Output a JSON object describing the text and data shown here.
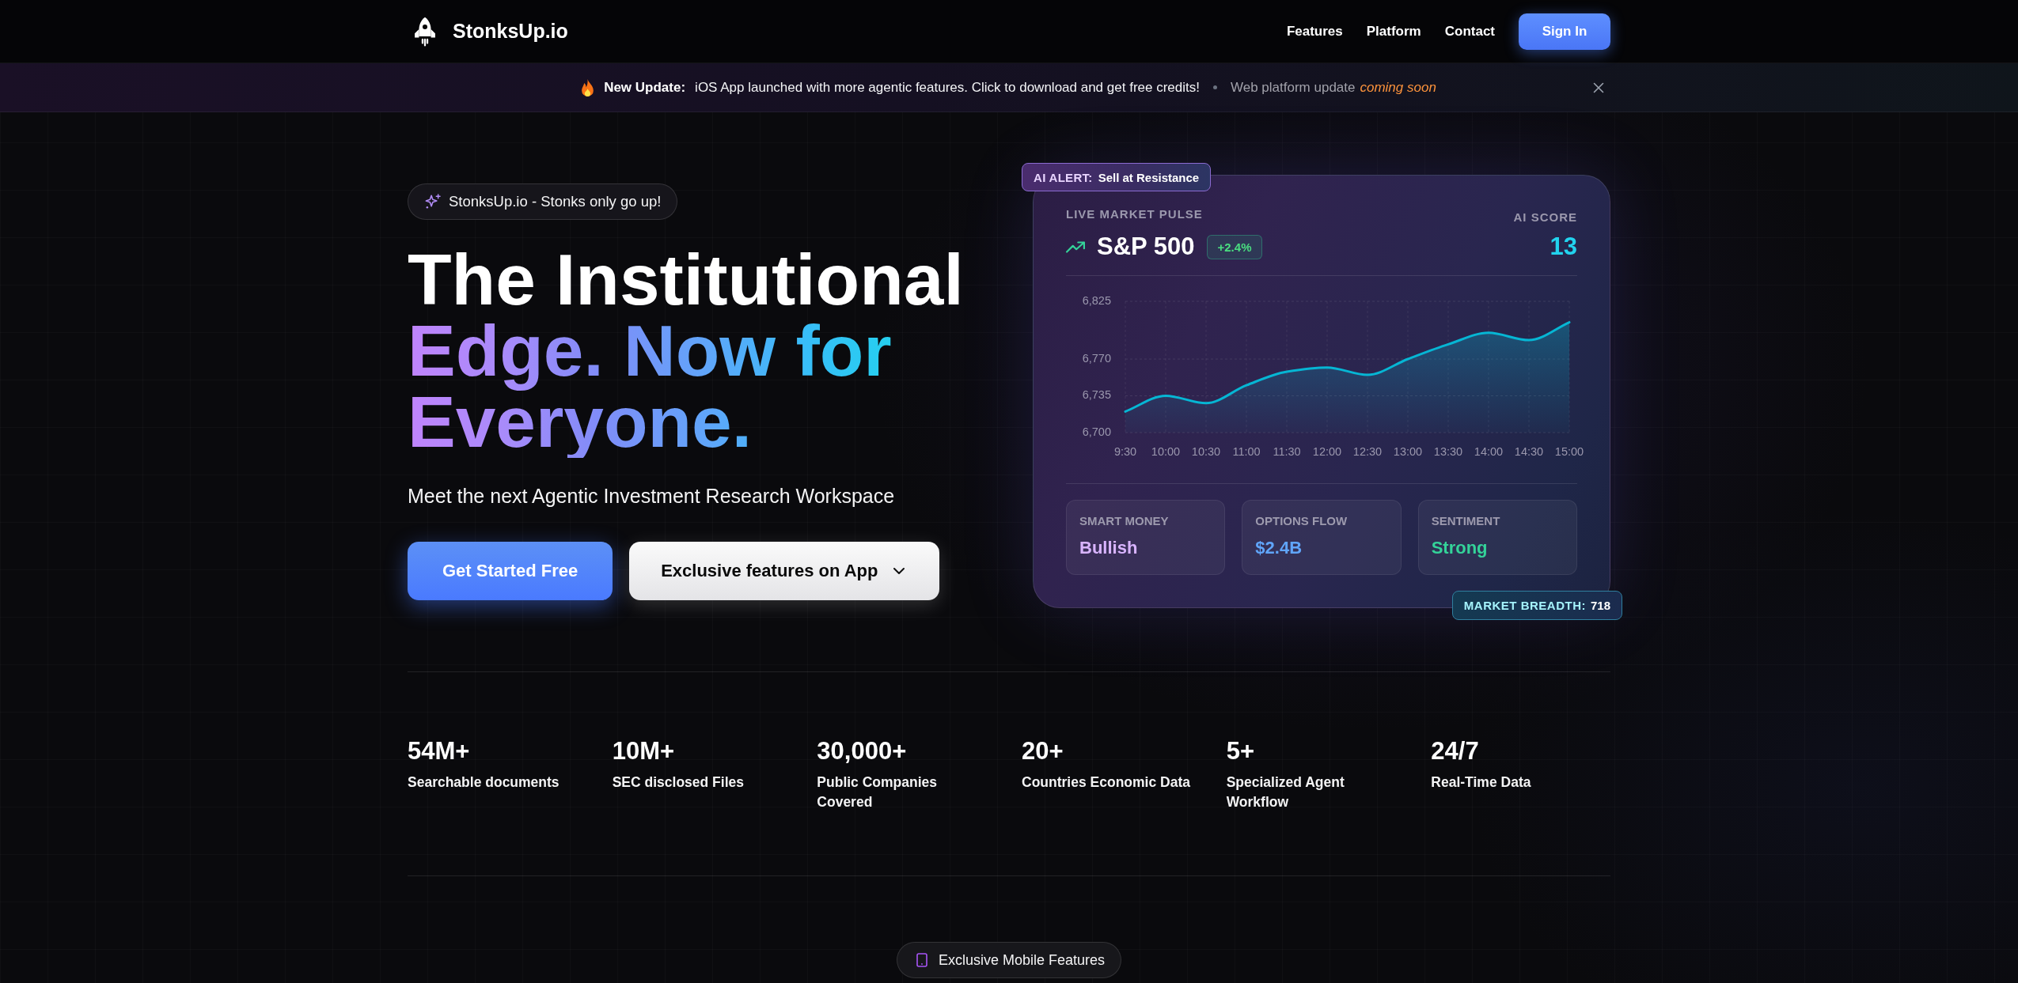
{
  "nav": {
    "brand": "StonksUp.io",
    "links": [
      "Features",
      "Platform",
      "Contact"
    ],
    "cta": "Sign In"
  },
  "announcement": {
    "label": "New Update:",
    "message": "iOS App launched with more agentic features. Click to download and get free credits!",
    "secondary": "Web platform update",
    "status": "coming soon"
  },
  "hero": {
    "tagline": "StonksUp.io - Stonks only go up!",
    "title": "The Institutional",
    "title_highlight": "Edge. Now for Everyone.",
    "subtitle": "Meet the next Agentic Investment Research Workspace",
    "primary_button": "Get Started Free",
    "secondary_button": "Exclusive features on App"
  },
  "market_card": {
    "alert": {
      "label": "AI ALERT:",
      "text": "Sell at Resistance"
    },
    "eyebrow": "LIVE MARKET PULSE",
    "index": "S&P 500",
    "change": "+2.4%",
    "score_label": "AI SCORE",
    "score": "13",
    "chart_data": {
      "type": "area",
      "grid": true,
      "categories": [
        "9:30",
        "10:00",
        "10:30",
        "11:00",
        "11:30",
        "12:00",
        "12:30",
        "13:00",
        "13:30",
        "14:00",
        "14:30",
        "15:00"
      ],
      "series": [
        {
          "color": "#06b6d4",
          "values": [
            6720,
            6735,
            6728,
            6745,
            6758,
            6762,
            6755,
            6770,
            6784,
            6795,
            6788,
            6805
          ]
        }
      ],
      "ylim": [
        6700,
        6825
      ],
      "yticks": [
        {
          "value": 6700,
          "label": "6,700"
        },
        {
          "value": 6735,
          "label": "6,735"
        },
        {
          "value": 6770,
          "label": "6,770"
        },
        {
          "value": 6825,
          "label": "6,825"
        }
      ]
    },
    "metrics": [
      {
        "label": "SMART MONEY",
        "value": "Bullish",
        "color": "#d8b4fe"
      },
      {
        "label": "OPTIONS FLOW",
        "value": "$2.4B",
        "color": "#60a5fa"
      },
      {
        "label": "SENTIMENT",
        "value": "Strong",
        "color": "#34d399"
      }
    ],
    "breadth": {
      "label": "MARKET BREADTH:",
      "value": "718"
    }
  },
  "stats": [
    {
      "value": "54M+",
      "label": "Searchable documents"
    },
    {
      "value": "10M+",
      "label": "SEC disclosed Files"
    },
    {
      "value": "30,000+",
      "label": "Public Companies Covered"
    },
    {
      "value": "20+",
      "label": "Countries Economic Data"
    },
    {
      "value": "5+",
      "label": "Specialized Agent Workflow"
    },
    {
      "value": "24/7",
      "label": "Real-Time Data"
    }
  ],
  "section_badge": "Exclusive Mobile Features"
}
